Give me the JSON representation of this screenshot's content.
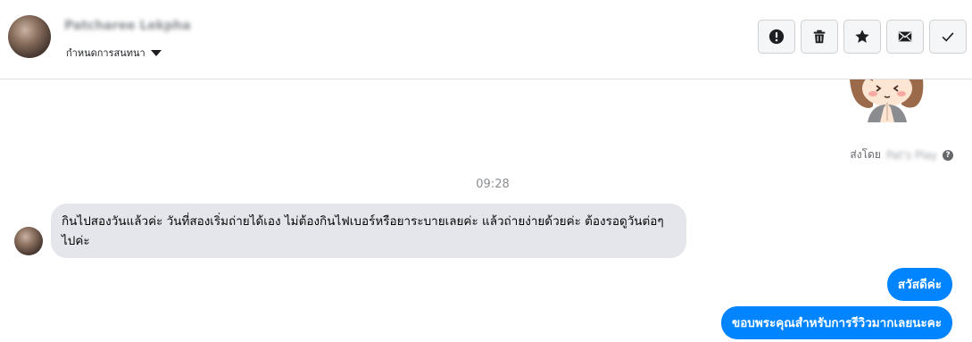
{
  "header": {
    "contact_name": "Patcharee Lekpha",
    "conversation_settings_label": "กำหนดการสนทนา",
    "toolbar": [
      {
        "name": "report-button",
        "icon": "exclamation-icon"
      },
      {
        "name": "delete-button",
        "icon": "trash-icon"
      },
      {
        "name": "star-button",
        "icon": "star-icon"
      },
      {
        "name": "mark-unread-button",
        "icon": "envelope-icon"
      },
      {
        "name": "mark-done-button",
        "icon": "checkmark-icon"
      }
    ]
  },
  "thread": {
    "sent_by_prefix": "ส่งโดย",
    "sent_by_name": "Pat's Play",
    "timestamp": "09:28",
    "incoming_message": "กินไปสองวันแล้วค่ะ วันที่สองเริ่มถ่ายได้เอง ไม่ต้องกินไฟเบอร์หรือยาระบายเลยค่ะ  แล้วถ่ายง่ายด้วยค่ะ ต้องรอดูวันต่อๆไปค่ะ",
    "outgoing_messages": [
      "สวัสดีค่ะ",
      "ขอบพระคุณสำหรับการรีวิวมากเลยนะคะ"
    ]
  },
  "colors": {
    "outgoing_bubble": "#0084ff",
    "incoming_bubble": "#e4e6eb",
    "divider": "#dddfe2"
  }
}
